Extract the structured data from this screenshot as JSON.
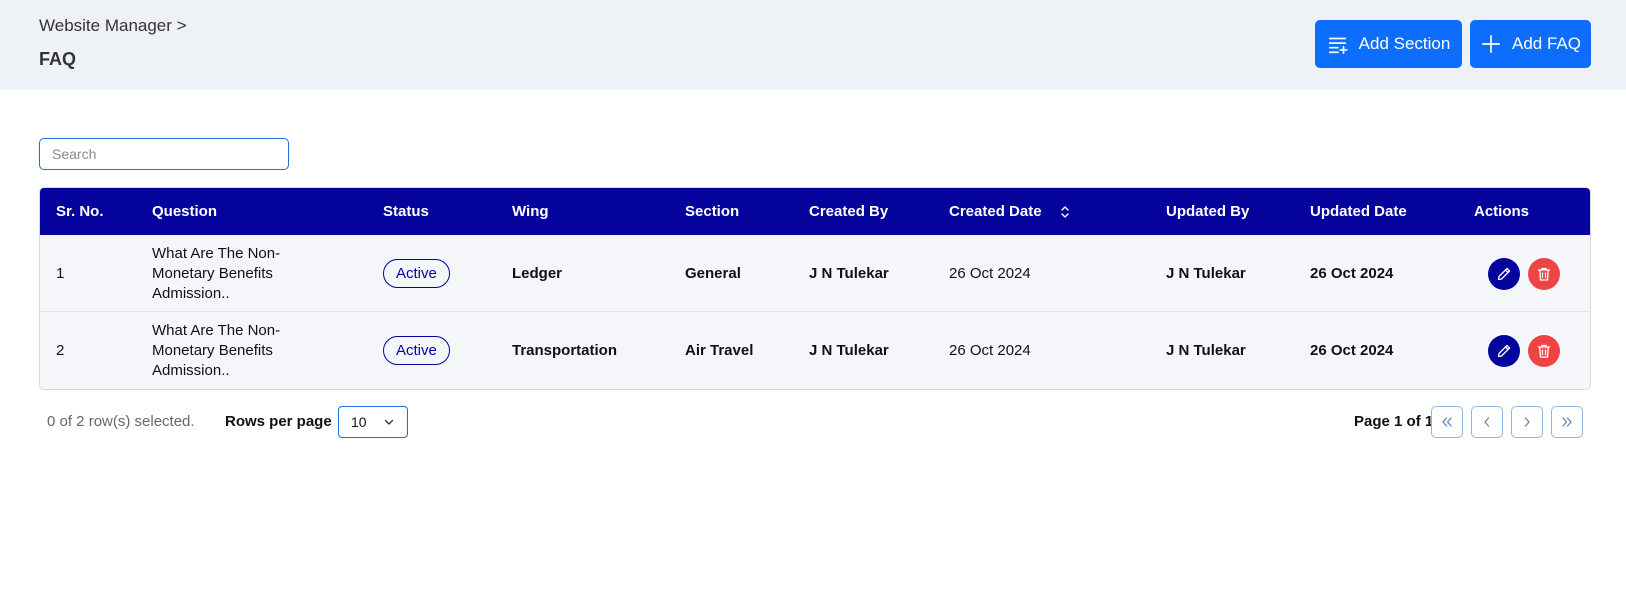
{
  "header": {
    "breadcrumb": "Website Manager >",
    "title": "FAQ",
    "add_section_label": "Add Section",
    "add_faq_label": "Add FAQ",
    "accent_color": "#0d6efd"
  },
  "search": {
    "placeholder": "Search"
  },
  "table": {
    "header_color": "#04049c",
    "columns": [
      "Sr. No.",
      "Question",
      "Status",
      "Wing",
      "Section",
      "Created By",
      "Created Date",
      "Updated By",
      "Updated Date",
      "Actions"
    ],
    "rows": [
      {
        "sr": "1",
        "question": "What Are The Non-Monetary Benefits Admission..",
        "status": "Active",
        "wing": "Ledger",
        "section": "General",
        "created_by": "J N Tulekar",
        "created_date": "26 Oct 2024",
        "updated_by": "J N Tulekar",
        "updated_date": "26 Oct 2024"
      },
      {
        "sr": "2",
        "question": "What Are The Non-Monetary Benefits Admission..",
        "status": "Active",
        "wing": "Transportation",
        "section": "Air Travel",
        "created_by": "J N Tulekar",
        "created_date": "26 Oct 2024",
        "updated_by": "J N Tulekar",
        "updated_date": "26 Oct 2024"
      }
    ]
  },
  "footer": {
    "selected_text": "0 of 2 row(s) selected.",
    "rows_per_page_label": "Rows per page",
    "rows_per_page_value": "10",
    "page_info": "Page 1 of 1"
  },
  "icons": {
    "add_section": "list-plus-icon",
    "add_faq": "plus-icon",
    "edit": "pencil-icon",
    "delete": "trash-icon",
    "sort": "sort-icon"
  }
}
